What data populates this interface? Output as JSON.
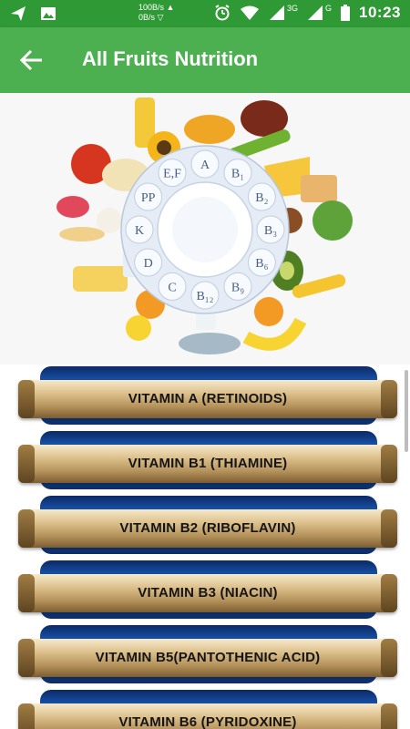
{
  "status_bar": {
    "net_up": "100B/s ▲",
    "net_down": "0B/s ▽",
    "network_3g": "3G",
    "network_g": "G",
    "time": "10:23"
  },
  "app_bar": {
    "title": "All Fruits Nutrition",
    "back_icon": "arrow-left-icon"
  },
  "hero": {
    "wheel_letters": [
      "A",
      "B₁",
      "B₂",
      "B₃",
      "B₆",
      "B₉",
      "B₁₂",
      "C",
      "D",
      "K",
      "PP",
      "E,F"
    ]
  },
  "vitamins": [
    {
      "label": "VITAMIN A (RETINOIDS)"
    },
    {
      "label": "VITAMIN B1 (THIAMINE)"
    },
    {
      "label": "VITAMIN B2 (RIBOFLAVIN)"
    },
    {
      "label": "VITAMIN B3 (NIACIN)"
    },
    {
      "label": "VITAMIN B5(PANTOTHENIC ACID)"
    },
    {
      "label": "VITAMIN B6 (PYRIDOXINE)"
    }
  ],
  "colors": {
    "status_bar": "#2f9a35",
    "app_bar": "#4caf50"
  }
}
